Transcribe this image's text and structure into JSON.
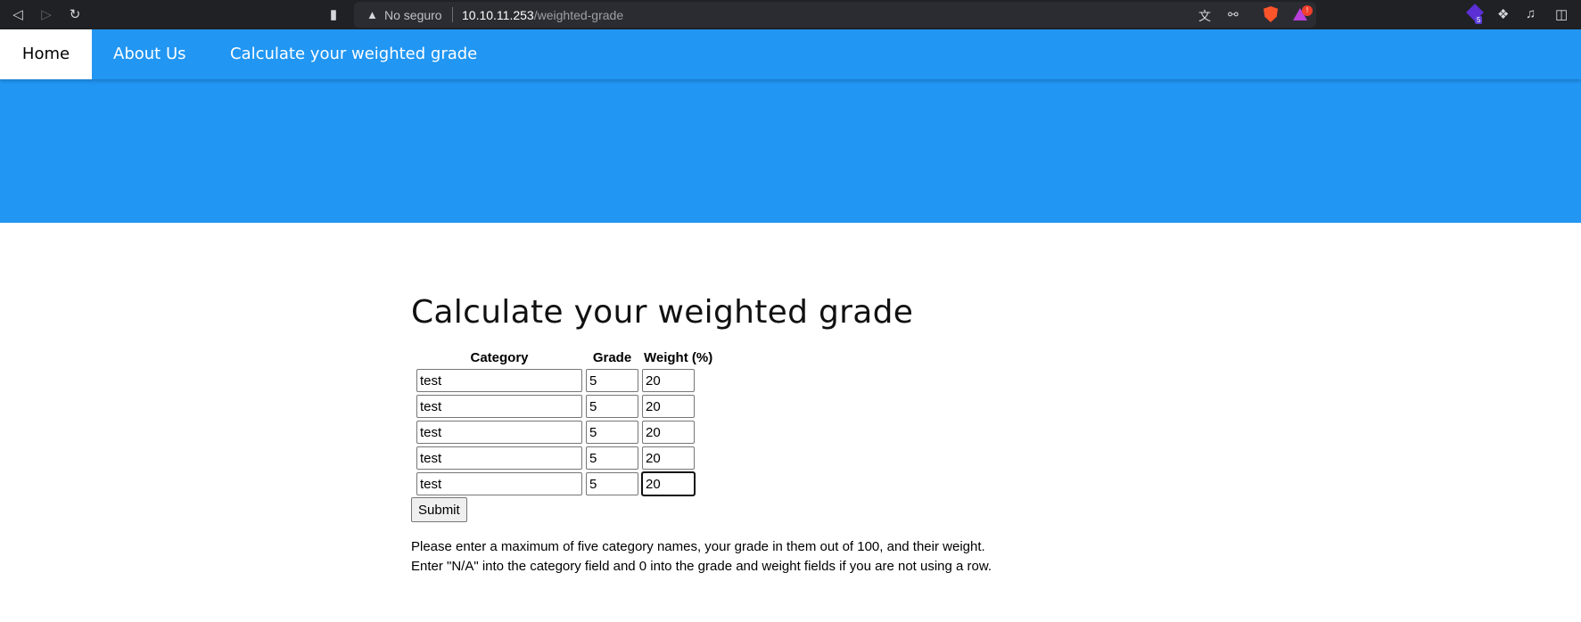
{
  "browser": {
    "security_label": "No seguro",
    "url_host": "10.10.11.253",
    "url_path": "/weighted-grade",
    "rewards_badge": "!",
    "extension_badge": "5"
  },
  "nav": {
    "items": [
      {
        "label": "Home",
        "active": true
      },
      {
        "label": "About Us",
        "active": false
      },
      {
        "label": "Calculate your weighted grade",
        "active": false
      }
    ]
  },
  "main": {
    "title": "Calculate your weighted grade",
    "table": {
      "headers": [
        "Category",
        "Grade",
        "Weight (%)"
      ],
      "rows": [
        {
          "category": "test",
          "grade": "5",
          "weight": "20"
        },
        {
          "category": "test",
          "grade": "5",
          "weight": "20"
        },
        {
          "category": "test",
          "grade": "5",
          "weight": "20"
        },
        {
          "category": "test",
          "grade": "5",
          "weight": "20"
        },
        {
          "category": "test",
          "grade": "5",
          "weight": "20"
        }
      ]
    },
    "submit_label": "Submit",
    "help": [
      "Please enter a maximum of five category names, your grade in them out of 100, and their weight.",
      "Enter \"N/A\" into the category field and 0 into the grade and weight fields if you are not using a row."
    ]
  },
  "colors": {
    "nav_bg": "#2196f3",
    "chrome_bg": "#202124"
  }
}
